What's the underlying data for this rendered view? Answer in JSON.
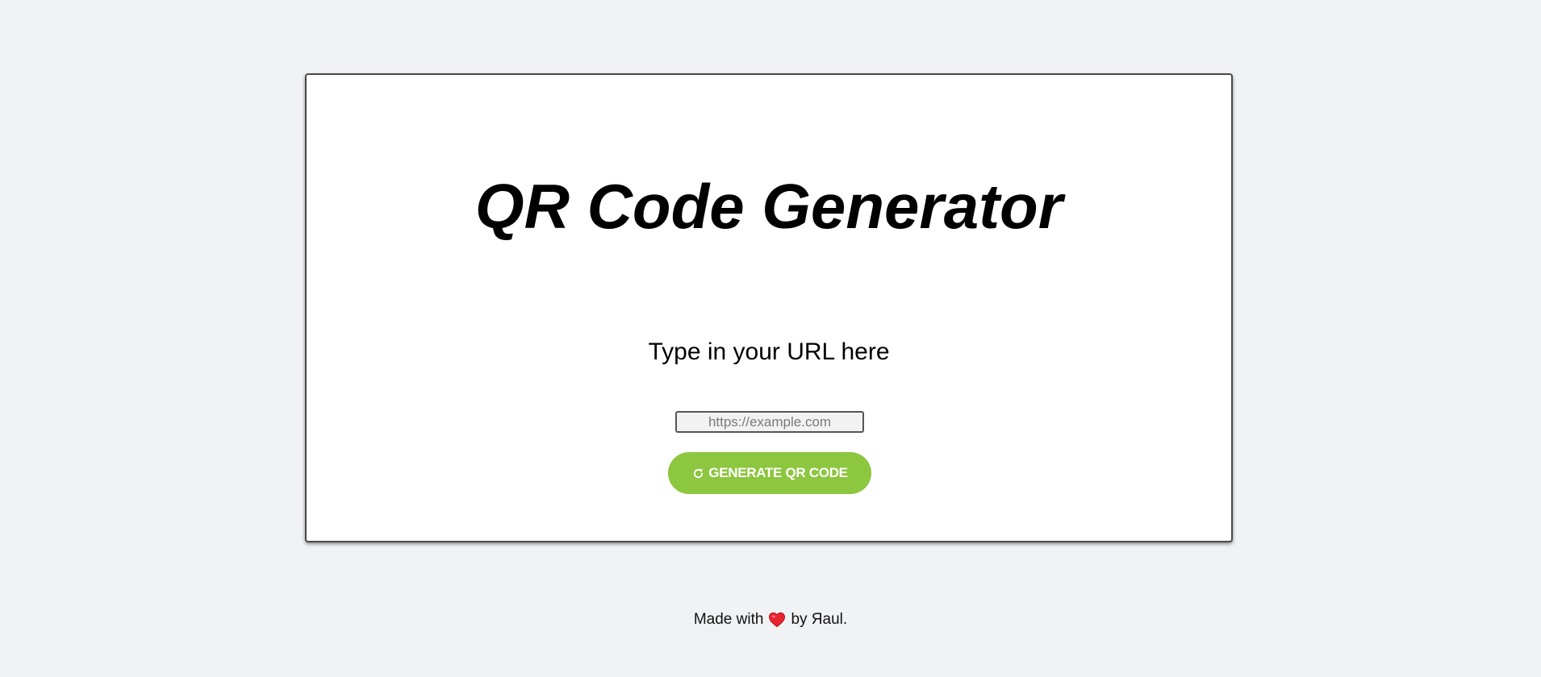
{
  "card": {
    "title": "QR Code Generator",
    "subtitle": "Type in your URL here",
    "url_input": {
      "value": "",
      "placeholder": "https://example.com"
    },
    "generate_button": {
      "label": "GENERATE QR CODE",
      "icon": "refresh-icon",
      "color": "#8dc63f"
    }
  },
  "footer": {
    "made_with": "Made with",
    "heart_icon": "heart-icon",
    "by": "by Яaul."
  }
}
